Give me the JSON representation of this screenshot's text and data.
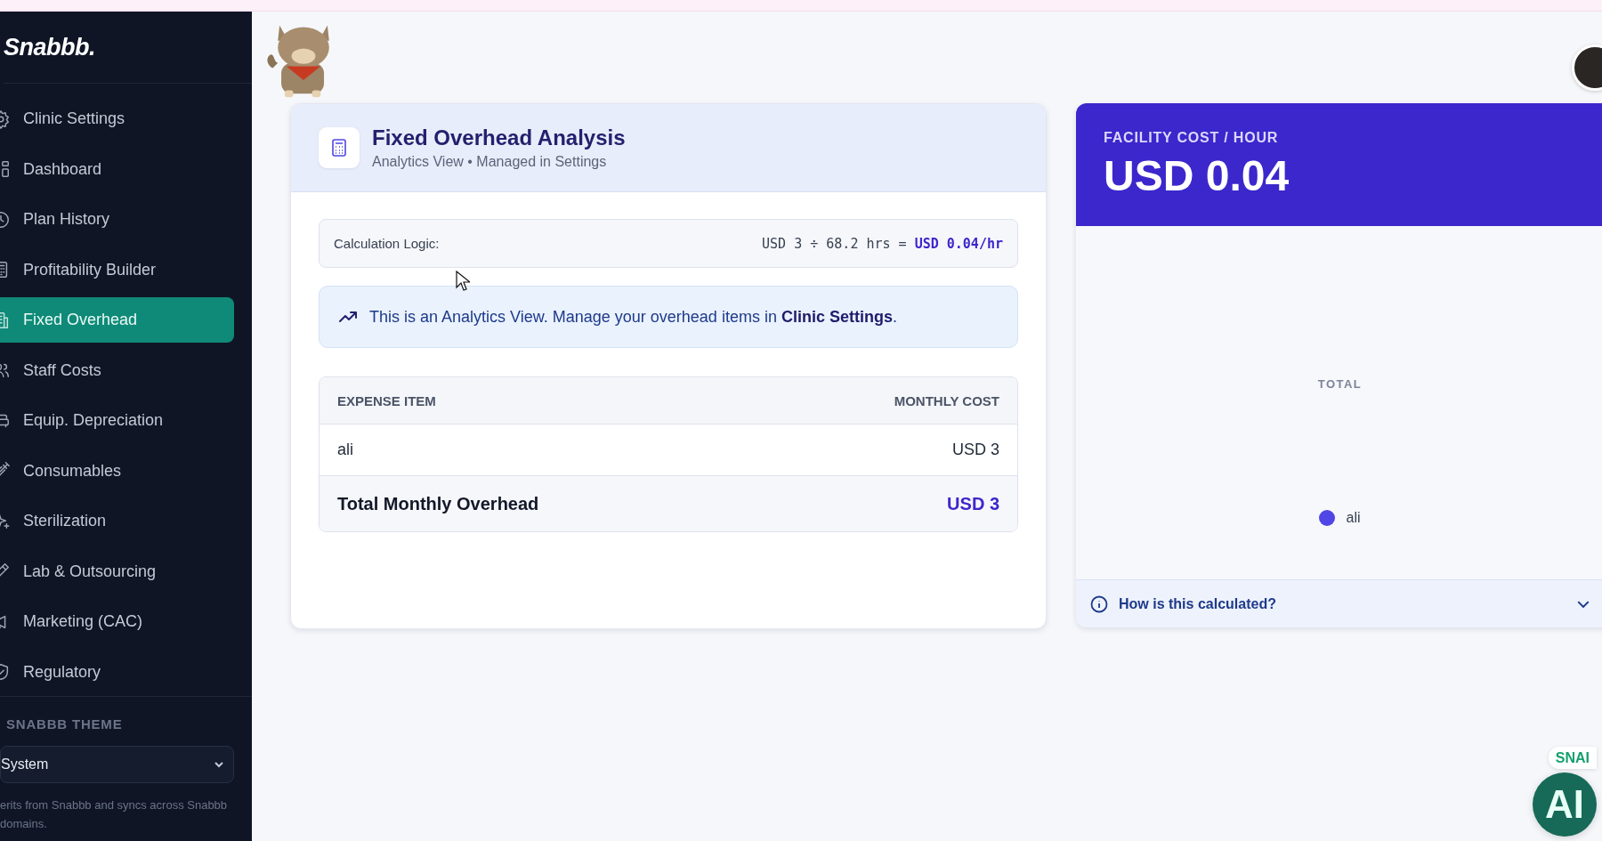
{
  "sidebar": {
    "logo": "Snabbb.",
    "items": [
      {
        "label": "Clinic Settings",
        "selected": false
      },
      {
        "label": "Dashboard",
        "selected": false
      },
      {
        "label": "Plan History",
        "selected": false
      },
      {
        "label": "Profitability Builder",
        "selected": false
      },
      {
        "label": "Fixed Overhead",
        "selected": true
      },
      {
        "label": "Staff Costs",
        "selected": false
      },
      {
        "label": "Equip. Depreciation",
        "selected": false
      },
      {
        "label": "Consumables",
        "selected": false
      },
      {
        "label": "Sterilization",
        "selected": false
      },
      {
        "label": "Lab & Outsourcing",
        "selected": false
      },
      {
        "label": "Marketing (CAC)",
        "selected": false
      },
      {
        "label": "Regulatory",
        "selected": false
      }
    ],
    "theme": {
      "label": "SNABBB THEME",
      "value": "System",
      "note": "erits from Snabbb and syncs across Snabbb domains."
    }
  },
  "analysis": {
    "title": "Fixed Overhead Analysis",
    "subtitle": "Analytics View • Managed in Settings",
    "logic_label": "Calculation Logic:",
    "logic_formula": "USD 3 ÷ 68.2 hrs = **USD 0.04/hr**",
    "banner": "This is an Analytics View. Manage your overhead items in **Clinic Settings**.",
    "table": {
      "columns": [
        "EXPENSE ITEM",
        "MONTHLY COST"
      ],
      "rows": [
        {
          "item": "ali",
          "cost": "USD 3"
        }
      ],
      "total": {
        "label": "Total Monthly Overhead",
        "value": "USD 3"
      }
    }
  },
  "facility": {
    "label": "FACILITY COST / HOUR",
    "value": "USD 0.04",
    "center_label": "TOTAL",
    "legend": [
      {
        "name": "ali",
        "color": "#4f46e5"
      }
    ],
    "footer": "How is this calculated?"
  },
  "assistant": {
    "badge": "SNAI",
    "label": "AI"
  }
}
